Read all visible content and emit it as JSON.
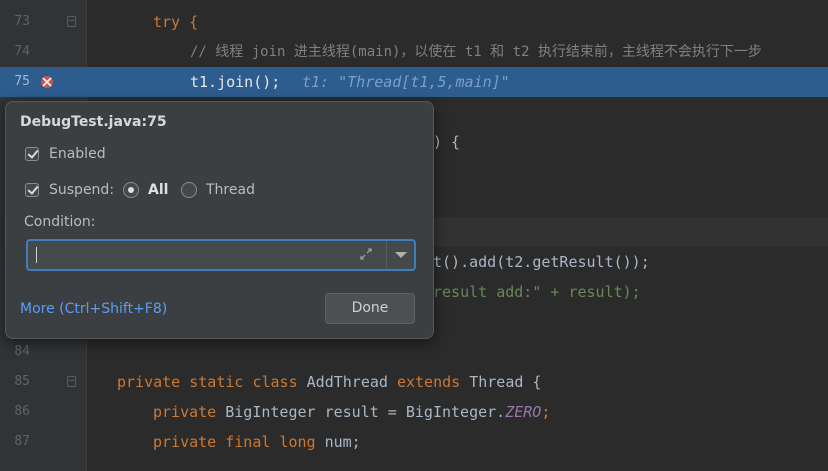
{
  "editor": {
    "lines": [
      {
        "num": "73",
        "code": "try {"
      },
      {
        "num": "74",
        "comment": "// 线程 join 进主线程(main)，以使在 t1 和 t2 执行结束前，主线程不会执行下一步"
      },
      {
        "num": "75",
        "code": "t1.join();",
        "inline_hint": "t1: \"Thread[t1,5,main]\""
      },
      {
        "num": "",
        "code": ") {"
      },
      {
        "num": "",
        "code": "t().add(t2.getResult());"
      },
      {
        "num": "",
        "code": "result add:\" + result);"
      },
      {
        "num": "84",
        "code": ""
      },
      {
        "num": "85",
        "kw": "private static class",
        "name": " AddThread ",
        "kw2": "extends",
        "rest": " Thread {"
      },
      {
        "num": "86",
        "kw": "private",
        "type": " BigInteger result = BigInteger.",
        "field": "ZERO",
        "end": ";"
      },
      {
        "num": "87",
        "kw": "private final long",
        "rest": " num;"
      }
    ]
  },
  "popup": {
    "title": "DebugTest.java:75",
    "enabled_label": "Enabled",
    "enabled_checked": true,
    "suspend_label": "Suspend:",
    "suspend_checked": true,
    "suspend_options": {
      "all": "All",
      "thread": "Thread"
    },
    "suspend_selected": "All",
    "condition_label": "Condition:",
    "condition_value": "",
    "more_link": "More (Ctrl+Shift+F8)",
    "done_button": "Done"
  },
  "icons": {
    "breakpoint": "breakpoint-disabled-icon",
    "expand": "expand-editor-icon",
    "dropdown": "chevron-down-icon"
  },
  "colors": {
    "background": "#2b2b2b",
    "highlight": "#2d5c8f",
    "keyword": "#cc7832",
    "link": "#589df6",
    "focus_border": "#3d7ec0"
  }
}
